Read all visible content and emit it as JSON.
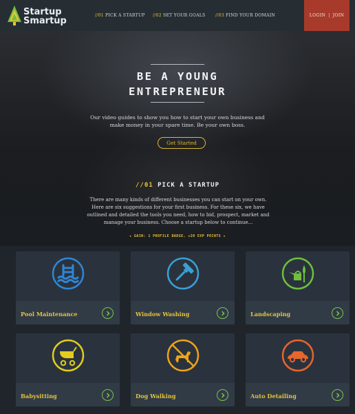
{
  "header": {
    "logo_line1": "Startup",
    "logo_line2": "Smartup",
    "nav": [
      {
        "num": "//01",
        "label": "PICK A STARTUP"
      },
      {
        "num": "//02",
        "label": "SET YOUR GOALS"
      },
      {
        "num": "//03",
        "label": "FIND YOUR DOMAIN"
      }
    ],
    "login": "LOGIN",
    "separator": "|",
    "join": "JOIN",
    "accent": "#e9c338",
    "login_bg": "#a83a2b"
  },
  "hero": {
    "title_line1": "BE A YOUNG",
    "title_line2": "ENTREPRENEUR",
    "text_line1": "Our video guides to show you how to start your own business and",
    "text_line2": "make money in your spare time.  Be your own boss.",
    "cta": "Get Started"
  },
  "section": {
    "num": "//01",
    "title": "PICK A STARTUP",
    "text_lines": [
      "There are many kinds of different businesses you can start on your own.",
      "Here are six suggestions for your first business.  For these six, we have",
      "outlined and detailed the tools you need, how to bid, prospect, market and",
      "manage your business.  Choose a startup below to continue..."
    ],
    "gain": "★ GAIN: 1 PROFILE BADGE, +20 EXP POINTS ★"
  },
  "cards": [
    {
      "label": "Pool Maintenance",
      "icon": "pool-ladder-icon",
      "color": "#2f86d8"
    },
    {
      "label": "Window Washing",
      "icon": "squeegee-icon",
      "color": "#3aa0d6"
    },
    {
      "label": "Landscaping",
      "icon": "watering-can-icon",
      "color": "#6fbf3c"
    },
    {
      "label": "Babysitting",
      "icon": "stroller-icon",
      "color": "#e2cd1d"
    },
    {
      "label": "Dog Walking",
      "icon": "dog-icon",
      "color": "#f0a318"
    },
    {
      "label": "Auto Detailing",
      "icon": "car-icon",
      "color": "#e8652c"
    }
  ]
}
